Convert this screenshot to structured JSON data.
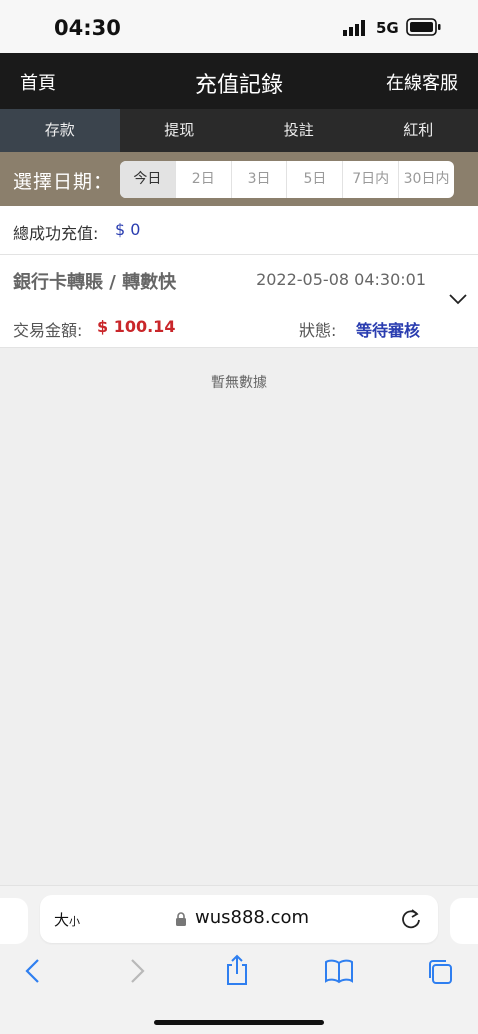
{
  "status": {
    "time": "04:30",
    "network": "5G"
  },
  "nav": {
    "left": "首頁",
    "title": "充值記錄",
    "right": "在線客服"
  },
  "tabs": [
    {
      "label": "存款"
    },
    {
      "label": "提现"
    },
    {
      "label": "投註"
    },
    {
      "label": "紅利"
    }
  ],
  "date_filter": {
    "label": "選擇日期：",
    "options": [
      "今日",
      "2日",
      "3日",
      "5日",
      "7日内",
      "30日内"
    ],
    "selected": "今日"
  },
  "summary": {
    "label": "總成功充值:",
    "value": "$ 0"
  },
  "record": {
    "method": "銀行卡轉賬 / 轉數快",
    "time": "2022-05-08 04:30:01",
    "amount_label": "交易金額:",
    "amount": "$ 100.14",
    "status_label": "狀態:",
    "status": "等待審核"
  },
  "empty_text": "暫無數據",
  "browser": {
    "text_size": "大",
    "text_size_small": "小",
    "url": "wus888.com"
  },
  "icons": {
    "signal": "signal-bars-icon",
    "battery": "battery-icon",
    "chevron": "chevron-down-icon",
    "lock": "lock-icon",
    "reload": "reload-icon",
    "back": "back-arrow-icon",
    "forward": "forward-arrow-icon",
    "share": "share-icon",
    "bookmarks": "bookmarks-icon",
    "tabs": "tabs-icon"
  },
  "colors": {
    "accent_blue": "#2a3db0",
    "amount_red": "#c9262a",
    "date_bar": "#8b7f6c",
    "nav_bg": "#1a1a1a"
  }
}
